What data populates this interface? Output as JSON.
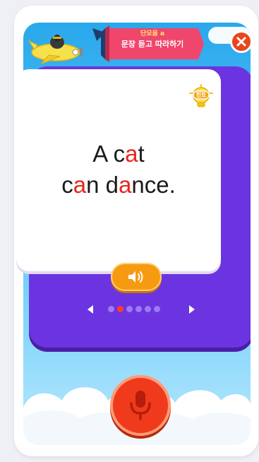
{
  "banner": {
    "subtitle": "단모음 a",
    "title": "문장 듣고 따라하기"
  },
  "card": {
    "hint_label": "힌트",
    "sentence_line1": [
      {
        "text": "A c",
        "highlight": false
      },
      {
        "text": "a",
        "highlight": true
      },
      {
        "text": "t",
        "highlight": false
      }
    ],
    "sentence_line2": [
      {
        "text": "c",
        "highlight": false
      },
      {
        "text": "a",
        "highlight": true
      },
      {
        "text": "n d",
        "highlight": false
      },
      {
        "text": "a",
        "highlight": true
      },
      {
        "text": "nce.",
        "highlight": false
      }
    ]
  },
  "pager": {
    "total": 6,
    "current": 2
  },
  "colors": {
    "board": "#6b34e0",
    "highlight": "#e8251c",
    "speaker": "#f69a12",
    "mic": "#ef3b1c",
    "close": "#e8461d"
  },
  "icons": {
    "close": "close-icon",
    "speaker": "speaker-icon",
    "mic": "microphone-icon",
    "hint": "lightbulb-icon"
  }
}
